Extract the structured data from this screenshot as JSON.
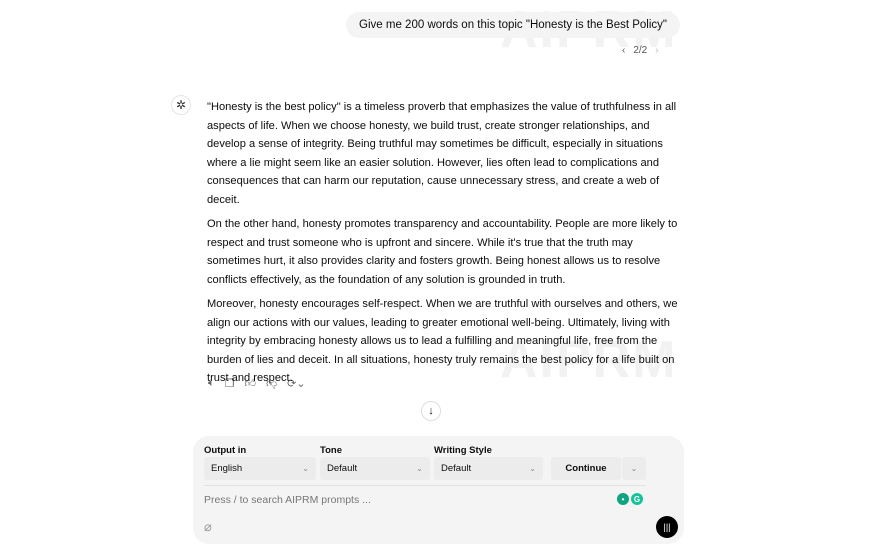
{
  "watermark": "AIPRM",
  "user_message": "Give me 200 words on this topic \"Honesty is the Best Policy\"",
  "pager": {
    "prev": "‹",
    "label": "2/2",
    "next": "›"
  },
  "assistant": {
    "paragraphs": [
      "\"Honesty is the best policy\" is a timeless proverb that emphasizes the value of truthfulness in all aspects of life. When we choose honesty, we build trust, create stronger relationships, and develop a sense of integrity. Being truthful may sometimes be difficult, especially in situations where a lie might seem like an easier solution. However, lies often lead to complications and consequences that can harm our reputation, cause unnecessary stress, and create a web of deceit.",
      "On the other hand, honesty promotes transparency and accountability. People are more likely to respect and trust someone who is upfront and sincere. While it's true that the truth may sometimes hurt, it also provides clarity and fosters growth. Being honest allows us to resolve conflicts effectively, as the foundation of any solution is grounded in truth.",
      "Moreover, honesty encourages self-respect. When we are truthful with ourselves and others, we align our actions with our values, leading to greater emotional well-being. Ultimately, living with integrity by embracing honesty allows us to lead a fulfilling and meaningful life, free from the burden of lies and deceit. In all situations, honesty truly remains the best policy for a life built on trust and respect."
    ]
  },
  "actions": [
    "speaker-icon",
    "copy-icon",
    "thumbs-up-icon",
    "thumbs-down-icon",
    "regenerate-icon"
  ],
  "composer": {
    "output_label": "Output in",
    "output_value": "English",
    "tone_label": "Tone",
    "tone_value": "Default",
    "style_label": "Writing Style",
    "style_value": "Default",
    "continue_label": "Continue",
    "placeholder": "Press / to search AIPRM prompts ..."
  },
  "colors": {
    "accent": "#10a37f",
    "bubble": "#f4f4f4"
  }
}
